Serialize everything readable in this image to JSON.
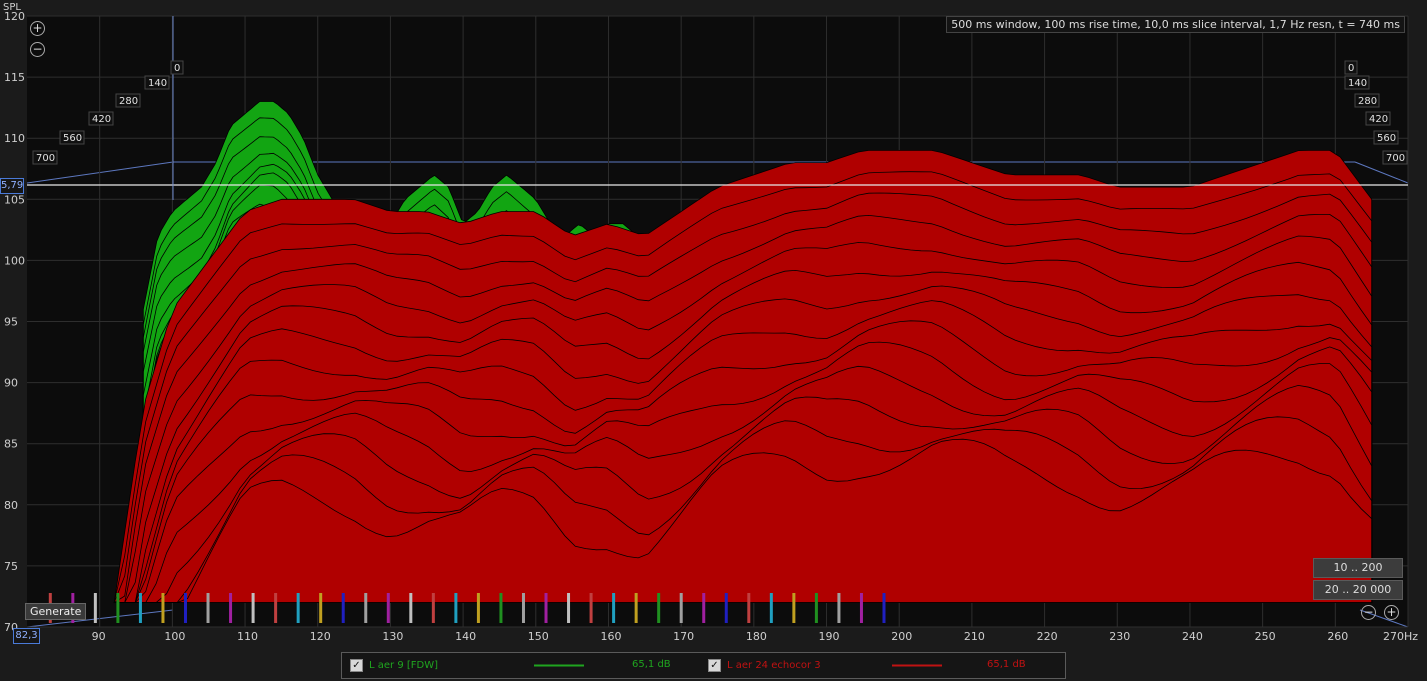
{
  "header": {
    "info": "500 ms window, 100 ms rise time, 10,0 ms slice interval, 1,7 Hz resn, t = 740 ms"
  },
  "readouts": {
    "y_cursor": "5,79",
    "x_cursor": "82,3"
  },
  "buttons": {
    "generate": "Generate",
    "range_low": "10 .. 200",
    "range_full": "20 .. 20 000"
  },
  "zoom": {
    "in": "+",
    "out": "−"
  },
  "legend": [
    {
      "label": "L aer 9 [FDW]",
      "value": "65,1 dB",
      "color": "#1fa51f",
      "checked": "✓"
    },
    {
      "label": "L aer 24 echocor 3",
      "value": "65,1 dB",
      "color": "#c01212",
      "checked": "✓"
    }
  ],
  "chart_data": {
    "type": "area",
    "ylabel": "SPL",
    "xunit": "Hz",
    "xlim": [
      80,
      270
    ],
    "ylim": [
      70,
      120
    ],
    "x_ticks": [
      "90",
      "100",
      "110",
      "120",
      "130",
      "140",
      "150",
      "160",
      "170",
      "180",
      "190",
      "200",
      "210",
      "220",
      "230",
      "240",
      "250",
      "260",
      "270Hz"
    ],
    "x_tick_values": [
      90,
      100,
      110,
      120,
      130,
      140,
      150,
      160,
      170,
      180,
      190,
      200,
      210,
      220,
      230,
      240,
      250,
      260,
      270
    ],
    "y_ticks": [
      "70",
      "75",
      "80",
      "85",
      "90",
      "95",
      "100",
      "105",
      "110",
      "115",
      "120"
    ],
    "y_tick_values": [
      70,
      75,
      80,
      85,
      90,
      95,
      100,
      105,
      110,
      115,
      120
    ],
    "time_ticks_ms": [
      "0",
      "140",
      "280",
      "420",
      "560",
      "700"
    ],
    "cursor_spl": 105.79,
    "series": [
      {
        "name": "L aer 9 [FDW]",
        "color": "#13a513",
        "x": [
          96,
          98,
          100,
          102,
          104,
          106,
          108,
          110,
          112,
          114,
          116,
          118,
          120,
          122,
          124,
          126,
          128,
          130,
          132,
          134,
          136,
          138,
          140,
          142,
          144,
          146,
          148,
          150,
          152,
          154,
          156,
          158,
          160,
          162,
          164,
          166,
          168,
          170
        ],
        "y": [
          96,
          102,
          104,
          105,
          106,
          108,
          111,
          112,
          113,
          113,
          112,
          110,
          107,
          105,
          103,
          102,
          102,
          103,
          105,
          106,
          107,
          106,
          103,
          104,
          106,
          107,
          106,
          105,
          103,
          102,
          103,
          102,
          103,
          103,
          102,
          101,
          102,
          103
        ]
      },
      {
        "name": "L aer 24 echocor 3",
        "color": "#b00000",
        "x": [
          92,
          96,
          100,
          105,
          110,
          115,
          120,
          125,
          130,
          135,
          140,
          145,
          150,
          155,
          160,
          165,
          170,
          175,
          180,
          185,
          190,
          195,
          200,
          205,
          210,
          215,
          220,
          225,
          230,
          235,
          240,
          245,
          250,
          255,
          260,
          265
        ],
        "y": [
          72,
          88,
          96,
          100,
          104,
          105,
          105,
          105,
          104,
          104,
          103,
          104,
          104,
          102,
          103,
          102,
          104,
          106,
          107,
          108,
          108,
          109,
          109,
          109,
          108,
          107,
          107,
          107,
          106,
          106,
          106,
          107,
          108,
          109,
          109,
          105
        ]
      }
    ]
  }
}
